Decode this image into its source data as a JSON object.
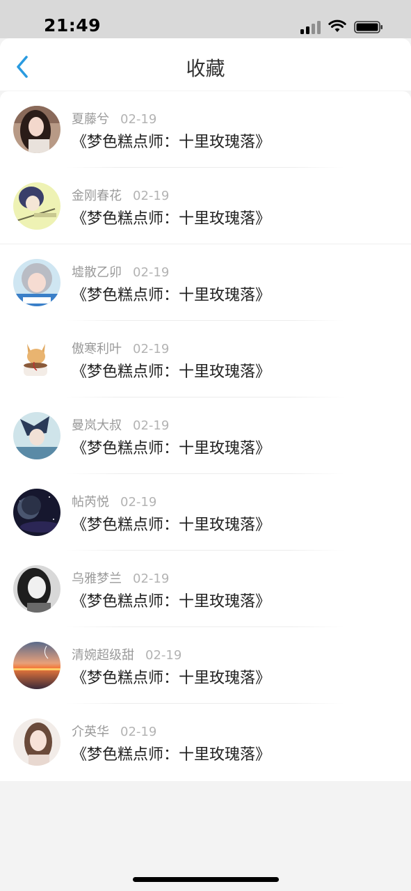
{
  "status_bar": {
    "time": "21:49"
  },
  "header": {
    "title": "收藏"
  },
  "items": [
    {
      "user": "夏藤兮",
      "date": "02-19",
      "title": "《梦色糕点师：十里玫瑰落》",
      "avatar_icon": "avatar-girl-dark-hair"
    },
    {
      "user": "金刚春花",
      "date": "02-19",
      "title": "《梦色糕点师：十里玫瑰落》",
      "avatar_icon": "avatar-anime-boy"
    },
    {
      "user": "墟散乙卯",
      "date": "02-19",
      "title": "《梦色糕点师：十里玫瑰落》",
      "avatar_icon": "avatar-girl-gray-hair"
    },
    {
      "user": "傲寒利叶",
      "date": "02-19",
      "title": "《梦色糕点师：十里玫瑰落》",
      "avatar_icon": "avatar-cat-coffee"
    },
    {
      "user": "曼岚大叔",
      "date": "02-19",
      "title": "《梦色糕点师：十里玫瑰落》",
      "avatar_icon": "avatar-anime-blue"
    },
    {
      "user": "帖芮悦",
      "date": "02-19",
      "title": "《梦色糕点师：十里玫瑰落》",
      "avatar_icon": "avatar-planet-space"
    },
    {
      "user": "乌雅梦兰",
      "date": "02-19",
      "title": "《梦色糕点师：十里玫瑰落》",
      "avatar_icon": "avatar-girl-bw"
    },
    {
      "user": "清婉超级甜",
      "date": "02-19",
      "title": "《梦色糕点师：十里玫瑰落》",
      "avatar_icon": "avatar-sunset"
    },
    {
      "user": "介英华",
      "date": "02-19",
      "title": "《梦色糕点师：十里玫瑰落》",
      "avatar_icon": "avatar-girl-light"
    }
  ],
  "colors": {
    "accent": "#2a9be0",
    "background": "#f3f3f3"
  }
}
